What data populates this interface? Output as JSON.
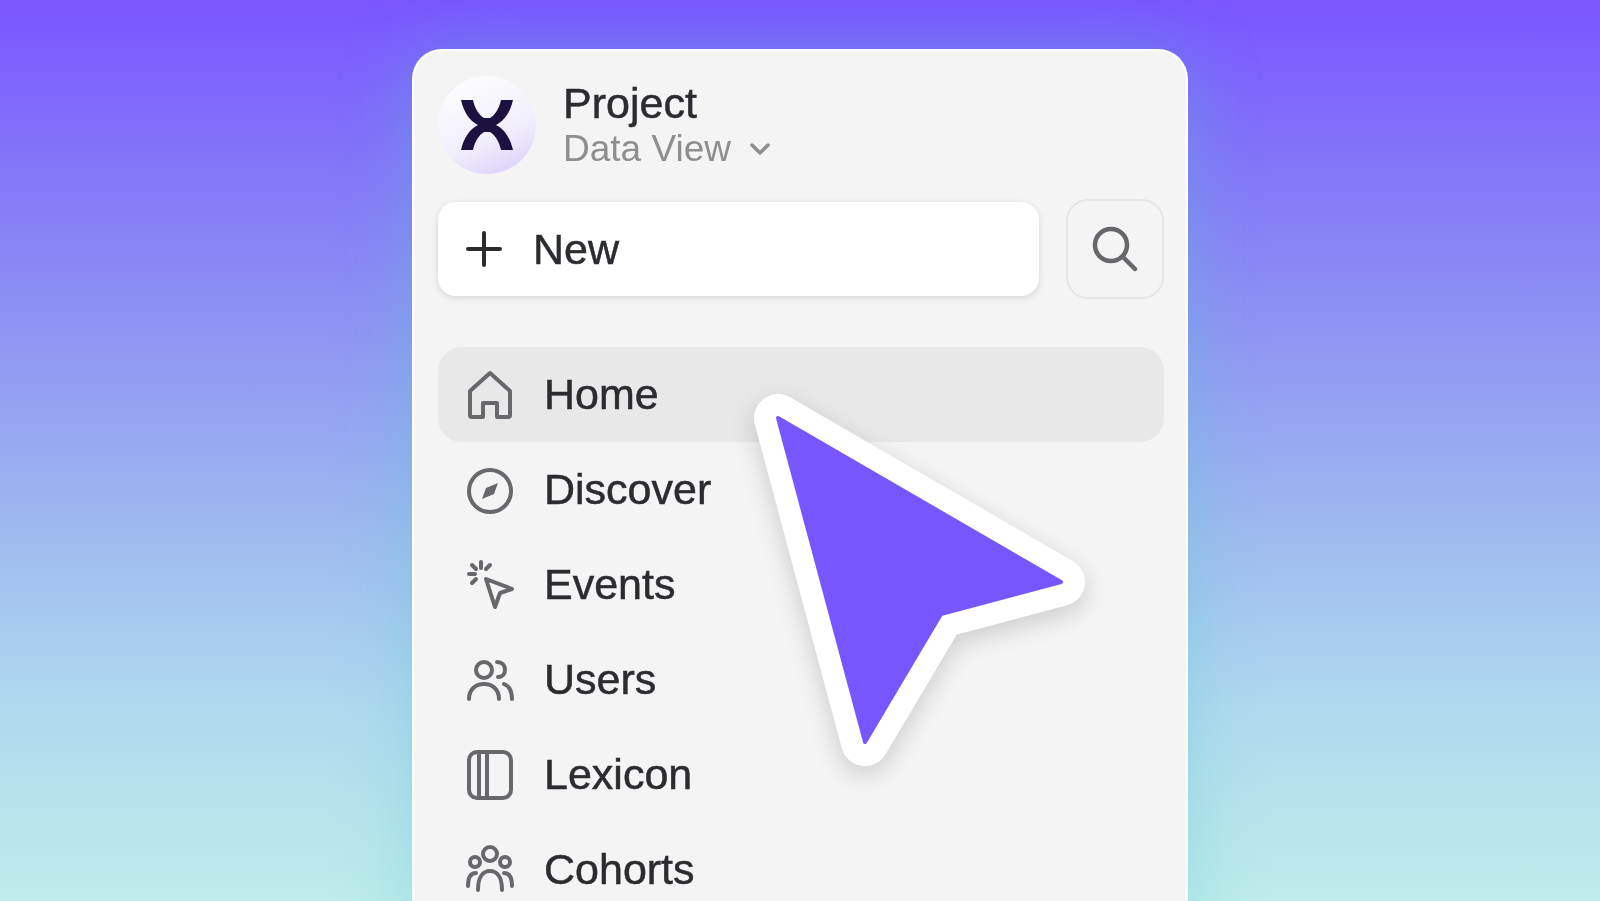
{
  "project": {
    "title": "Project",
    "view": "Data View"
  },
  "new_button": {
    "label": "New"
  },
  "nav": [
    {
      "label": "Home",
      "kind": "home",
      "selected": true
    },
    {
      "label": "Discover",
      "kind": "discover",
      "selected": false
    },
    {
      "label": "Events",
      "kind": "events",
      "selected": false
    },
    {
      "label": "Users",
      "kind": "users",
      "selected": false
    },
    {
      "label": "Lexicon",
      "kind": "lexicon",
      "selected": false
    },
    {
      "label": "Cohorts",
      "kind": "cohorts",
      "selected": false
    }
  ]
}
